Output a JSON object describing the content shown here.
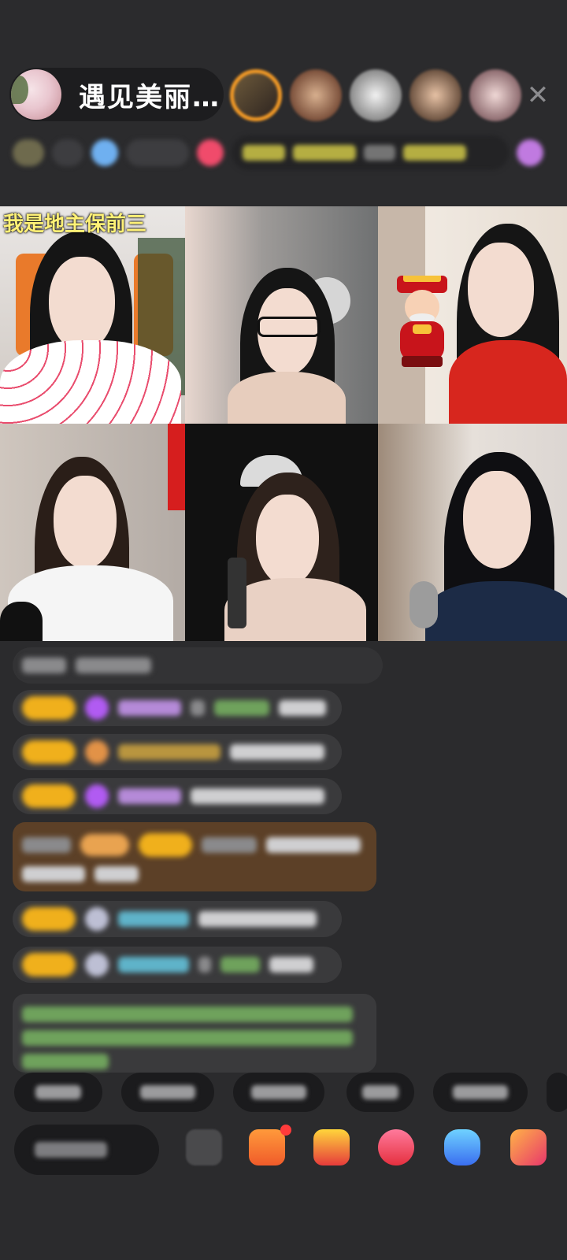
{
  "header": {
    "host_name": "遇见美丽…",
    "close_icon": "close-icon",
    "viewers": [
      "viewer-1",
      "viewer-2",
      "viewer-3",
      "viewer-4",
      "viewer-5"
    ]
  },
  "video_grid": {
    "caption": "我是地主保前三",
    "tiles": 6
  },
  "chat": {
    "messages": 9
  },
  "bottom": {
    "quick_replies": 6,
    "tools": [
      "emoji-icon",
      "gift-box-icon",
      "treasure-icon",
      "heart-icon",
      "game-controller-icon",
      "more-apps-icon"
    ]
  },
  "colors": {
    "background": "#2b2b2d",
    "caption": "#fff176",
    "badge": "#f0b01c",
    "accent_orange": "#f39a26"
  }
}
